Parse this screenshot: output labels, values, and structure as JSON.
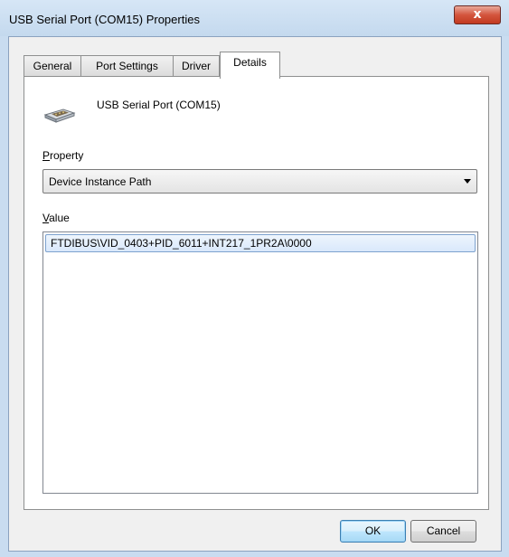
{
  "window": {
    "title": "USB Serial Port (COM15) Properties",
    "close_glyph": "x"
  },
  "tabs": [
    {
      "label": "General",
      "active": false
    },
    {
      "label": "Port Settings",
      "active": false
    },
    {
      "label": "Driver",
      "active": false
    },
    {
      "label": "Details",
      "active": true
    }
  ],
  "device": {
    "icon": "serial-port-connector-icon",
    "name": "USB Serial Port (COM15)"
  },
  "property": {
    "label_accel": "P",
    "label_rest": "roperty",
    "selected": "Device Instance Path"
  },
  "value": {
    "label_accel": "V",
    "label_rest": "alue",
    "items": [
      "FTDIBUS\\VID_0403+PID_6011+INT217_1PR2A\\0000"
    ]
  },
  "buttons": {
    "ok": "OK",
    "cancel": "Cancel"
  }
}
